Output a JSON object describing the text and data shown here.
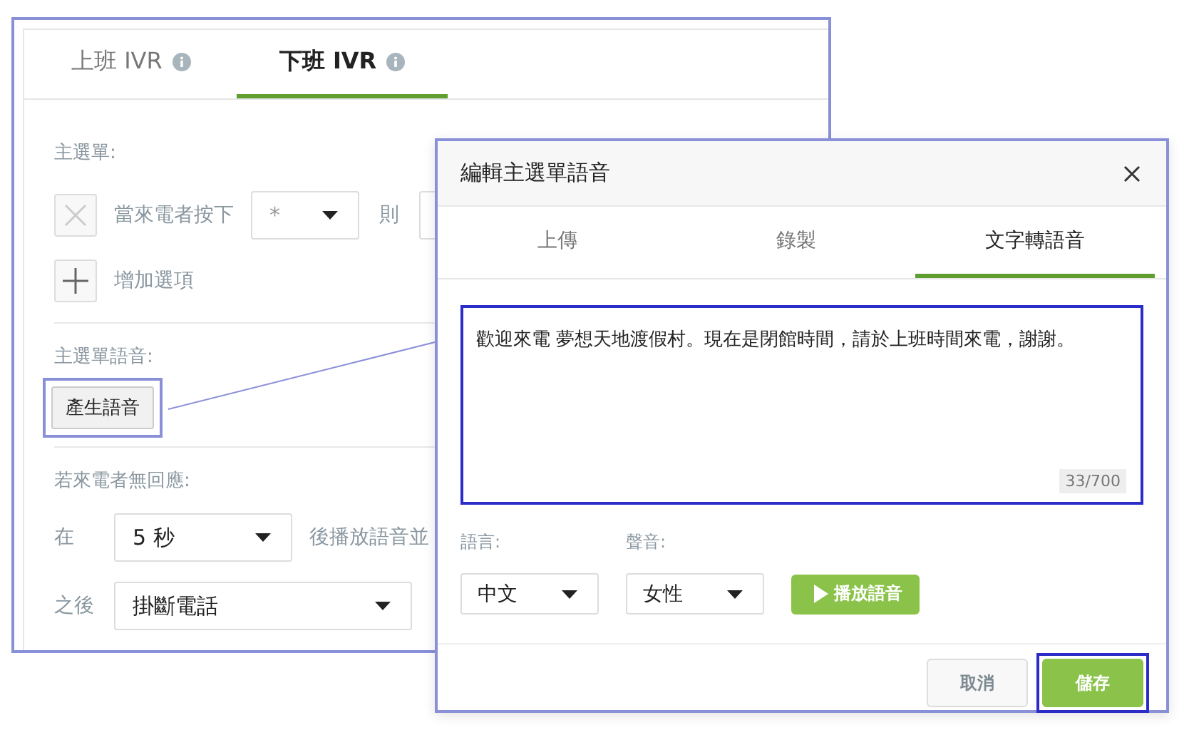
{
  "background_panel": {
    "tabs": [
      {
        "label": "上班 IVR",
        "selected": false
      },
      {
        "label": "下班 IVR",
        "selected": true
      }
    ],
    "main_menu_label": "主選單:",
    "option_row": {
      "prefix": "當來電者按下",
      "key_value": "*",
      "then_label": "則"
    },
    "add_option": "增加選項",
    "voice_label": "主選單語音:",
    "generate_button": {
      "label": "產生語音",
      "highlighted": true
    },
    "no_response_label": "若來電者無回應:",
    "wait_row": {
      "prefix": "在",
      "value": "5 秒",
      "suffix": "後播放語音並"
    },
    "after_row": {
      "prefix": "之後",
      "value": "掛斷電話"
    }
  },
  "dialog": {
    "title": "編輯主選單語音",
    "tabs": [
      {
        "label": "上傳",
        "selected": false
      },
      {
        "label": "錄製",
        "selected": false
      },
      {
        "label": "文字轉語音",
        "selected": true
      }
    ],
    "message": {
      "text": "歡迎來電 夢想天地渡假村。現在是閉館時間，請於上班時間來電，謝謝。",
      "counter": "33/700",
      "highlighted": true
    },
    "language": {
      "label": "語言:",
      "value": "中文"
    },
    "voice": {
      "label": "聲音:",
      "value": "女性"
    },
    "play_button": "播放語音",
    "buttons": [
      {
        "label": "取消",
        "kind": "secondary",
        "highlighted": false
      },
      {
        "label": "儲存",
        "kind": "primary",
        "highlighted": true
      }
    ]
  }
}
